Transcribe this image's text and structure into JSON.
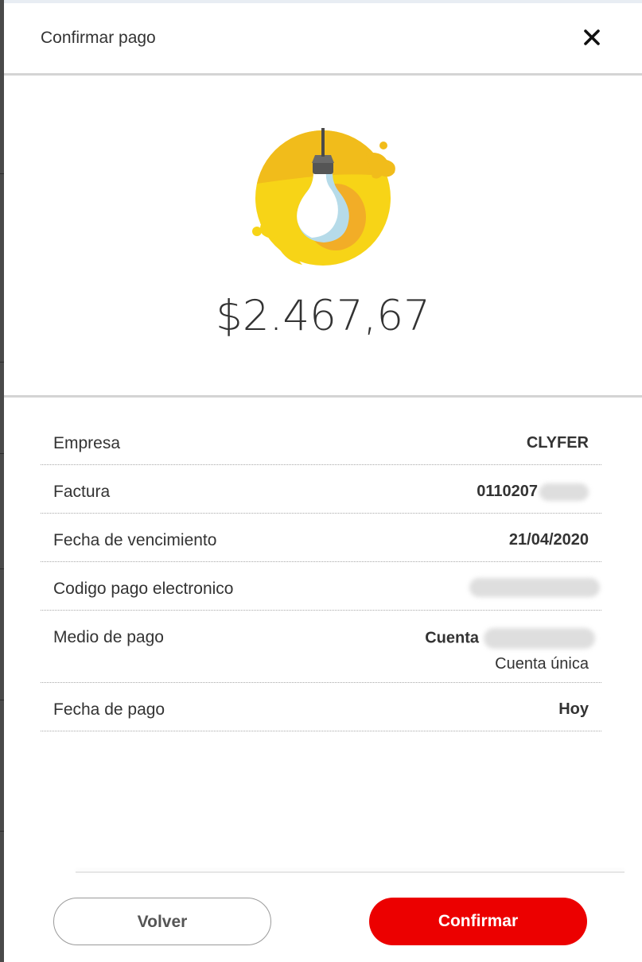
{
  "dialog": {
    "title": "Confirmar pago",
    "close_icon": "close-icon"
  },
  "hero": {
    "icon": "lightbulb-illustration",
    "amount": "$2.467,67",
    "colors": {
      "yellow": "#f7d417",
      "yellow_dark": "#f1bc1b",
      "bulb_shade": "#b6dbe9"
    }
  },
  "details": {
    "empresa": {
      "label": "Empresa",
      "value": "CLYFER"
    },
    "factura": {
      "label": "Factura",
      "value": "0110207"
    },
    "vencimiento": {
      "label": "Fecha de vencimiento",
      "value": "21/04/2020"
    },
    "codigo": {
      "label": "Codigo pago electronico"
    },
    "medio": {
      "label": "Medio de pago",
      "value": "Cuenta",
      "sub": "Cuenta única"
    },
    "fecha_pago": {
      "label": "Fecha de pago",
      "value": "Hoy"
    }
  },
  "actions": {
    "back_label": "Volver",
    "confirm_label": "Confirmar",
    "confirm_color": "#ec0000"
  }
}
